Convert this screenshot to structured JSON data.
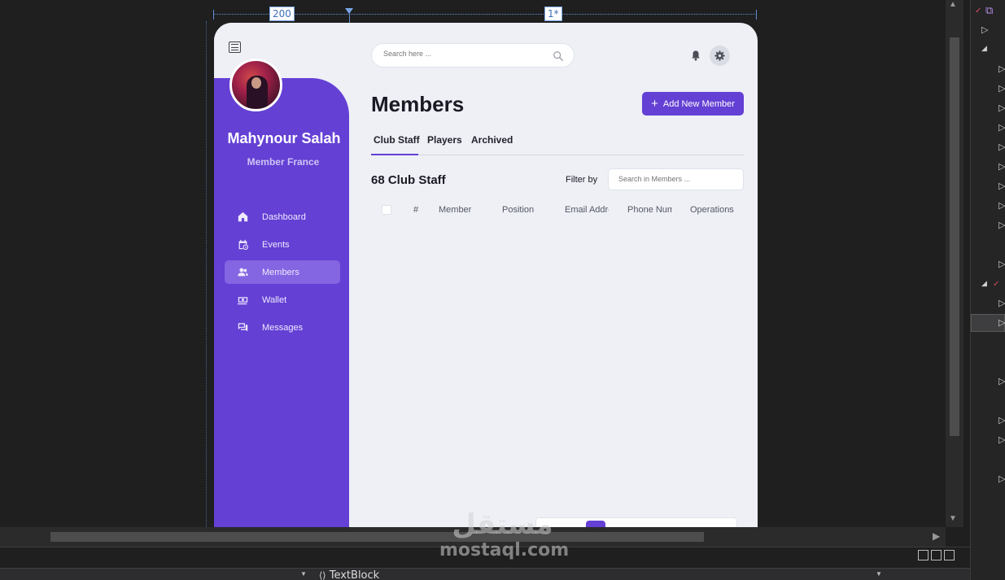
{
  "designer": {
    "col_label_left": "200",
    "col_label_right": "1*"
  },
  "xaml_bar": {
    "element_type": "TextBlock"
  },
  "app": {
    "user": {
      "name": "Mahynour Salah",
      "role": "Member France"
    },
    "nav": [
      {
        "label": "Dashboard",
        "icon": "home-icon",
        "active": false
      },
      {
        "label": "Events",
        "icon": "calendar-clock-icon",
        "active": false
      },
      {
        "label": "Members",
        "icon": "people-icon",
        "active": true
      },
      {
        "label": "Wallet",
        "icon": "money-icon",
        "active": false
      },
      {
        "label": "Messages",
        "icon": "chat-icon",
        "active": false
      }
    ],
    "search": {
      "placeholder": "Search here ..."
    },
    "header_icons": [
      "bell-icon",
      "gear-icon"
    ],
    "page_title": "Members",
    "add_button": {
      "label": "Add New Member"
    },
    "tabs": [
      {
        "label": "Club Staff",
        "active": true
      },
      {
        "label": "Players",
        "active": false
      },
      {
        "label": "Archived",
        "active": false
      }
    ],
    "count_title": "68 Club Staff",
    "filter": {
      "label": "Filter by",
      "placeholder": "Search in Members ..."
    },
    "table": {
      "columns": [
        "#",
        "Member",
        "Position",
        "Email Address",
        "Phone Number",
        "Operations"
      ],
      "rows": []
    }
  },
  "colors": {
    "accent": "#6440d4",
    "nav_active": "#8465e2",
    "page_bg": "#eef0f6"
  },
  "watermark": {
    "arabic": "مستقل",
    "latin": "mostaql.com"
  }
}
